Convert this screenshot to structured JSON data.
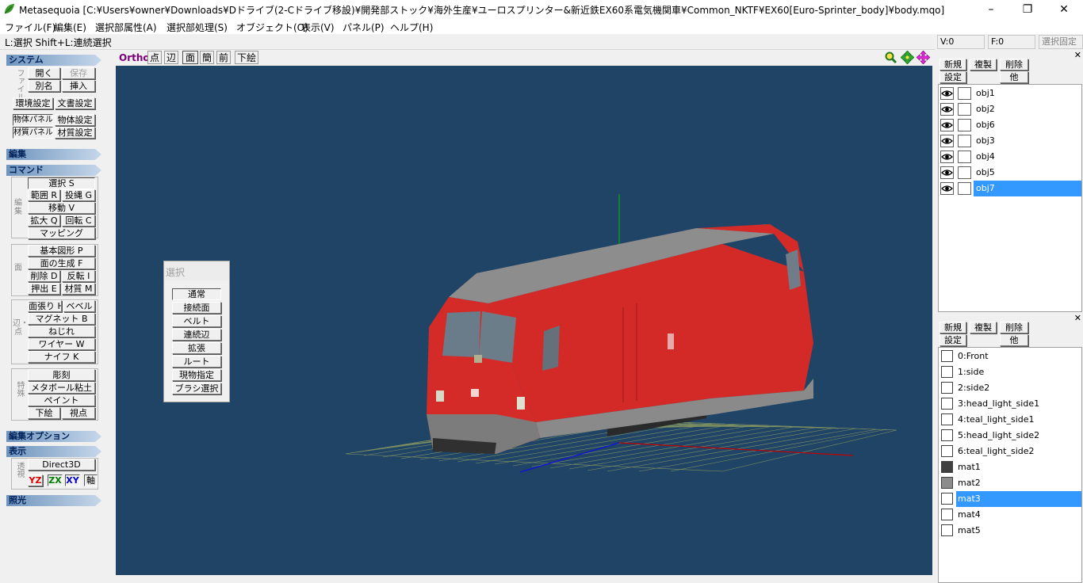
{
  "window": {
    "title": "Metasequoia [C:¥Users¥owner¥Downloads¥Dドライブ(2-Cドライブ移設)¥開発部ストック¥海外生産¥ユーロスプリンター&新近鉄EX60系電気機関車¥Common_NKTF¥EX60[Euro-Sprinter_body]¥body.mqo]",
    "minimize": "–",
    "maximize": "❐",
    "close": "✕"
  },
  "menu": [
    "ファイル(F)",
    "編集(E)",
    "選択部属性(A)",
    "選択部処理(S)",
    "オブジェクト(O)",
    "表示(V)",
    "パネル(P)",
    "ヘルプ(H)"
  ],
  "hint": "L:選択  Shift+L:連続選択",
  "status": {
    "v": "V:0",
    "f": "F:0",
    "lock": "選択固定"
  },
  "left": {
    "system": {
      "header": "システム",
      "file_label": "ファイル",
      "open": "開く",
      "save": "保存",
      "rename": "別名",
      "insert": "挿入",
      "env": "環境設定",
      "doc": "文書設定",
      "obj_panel": "物体パネル",
      "obj_settings": "物体設定",
      "mat_panel": "材質パネル",
      "mat_settings": "材質設定"
    },
    "edit_header": "編集",
    "command": {
      "header": "コマンド",
      "edit_label": "編集",
      "select": "選択 S",
      "range": "範囲 R",
      "lasso": "投縄 G",
      "move": "移動 V",
      "scale": "拡大 Q",
      "rotate": "回転 C",
      "mapping": "マッピング",
      "face_label": "面",
      "primitive": "基本図形 P",
      "make_face": "面の生成 F",
      "delete": "削除 D",
      "invert": "反転 I",
      "extrude": "押出 E",
      "material": "材質 M",
      "edge_label": "辺・点",
      "stretch": "面張り H",
      "bevel": "ベベル",
      "magnet": "マグネット B",
      "twist": "ねじれ",
      "wire": "ワイヤー W",
      "knife": "ナイフ K",
      "special_label": "特殊",
      "sculpt": "彫刻",
      "metaball": "メタボール粘土",
      "paint": "ペイント",
      "underlay": "下絵",
      "viewpoint": "視点"
    },
    "edit_option_header": "編集オプション",
    "display": {
      "header": "表示",
      "view_label": "透視",
      "direct3d": "Direct3D",
      "yz": "YZ",
      "zx": "ZX",
      "xy": "XY",
      "axis": "軸"
    },
    "light_header": "照光"
  },
  "viewbar": {
    "ortho": "Ortho",
    "point": "点",
    "edge": "辺",
    "face": "面",
    "simple": "簡",
    "front": "前",
    "underlay": "下絵",
    "zoom_icon": "magnifier-icon",
    "move_icon": "move-arrows-icon",
    "rotate_icon": "rotate-icon"
  },
  "select_panel": {
    "title": "選択",
    "options": [
      "通常",
      "接続面",
      "ベルト",
      "連続辺",
      "拡張",
      "ルート",
      "現物指定",
      "ブラシ選択"
    ]
  },
  "object_panel": {
    "new": "新規",
    "copy": "複製",
    "delete": "削除",
    "settings": "設定",
    "other": "他",
    "objects": [
      "obj1",
      "obj2",
      "obj6",
      "obj3",
      "obj4",
      "obj5",
      "obj7"
    ],
    "selected": "obj7"
  },
  "material_panel": {
    "new": "新規",
    "copy": "複製",
    "delete": "削除",
    "settings": "設定",
    "other": "他",
    "materials": [
      {
        "name": "0:Front",
        "color": "#ffffff"
      },
      {
        "name": "1:side",
        "color": "#ffffff"
      },
      {
        "name": "2:side2",
        "color": "#ffffff"
      },
      {
        "name": "3:head_light_side1",
        "color": "#ffffff"
      },
      {
        "name": "4:teal_light_side1",
        "color": "#ffffff"
      },
      {
        "name": "5:head_light_side2",
        "color": "#ffffff"
      },
      {
        "name": "6:teal_light_side2",
        "color": "#ffffff"
      },
      {
        "name": "mat1",
        "color": "#404040"
      },
      {
        "name": "mat2",
        "color": "#8c8c8c"
      },
      {
        "name": "mat3",
        "color": "#ffffff"
      },
      {
        "name": "mat4",
        "color": "#ffffff"
      },
      {
        "name": "mat5",
        "color": "#ffffff"
      }
    ],
    "selected": "mat3"
  },
  "colors": {
    "viewport_bg": "#1f4466",
    "selection": "#3399ff",
    "section_header": "#6e94bd",
    "loco_red": "#d32a28",
    "loco_gray": "#8a8a8a"
  }
}
